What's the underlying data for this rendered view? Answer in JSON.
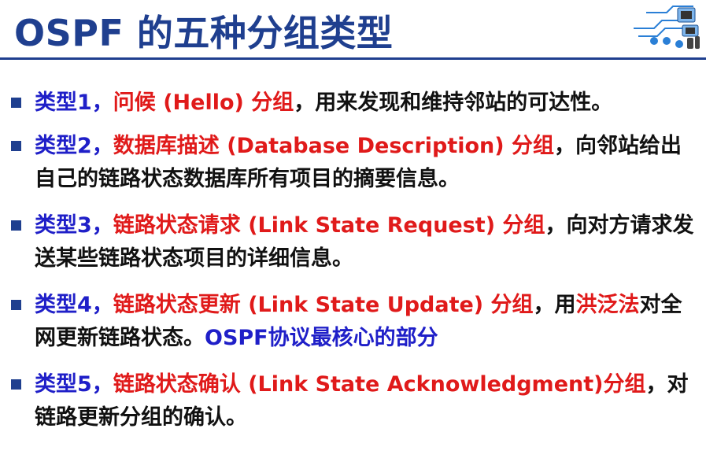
{
  "title": "OSPF 的五种分组类型",
  "colors": {
    "title": "#1f3f8f",
    "type": "#1f1fc8",
    "name": "#e01a1a",
    "text": "#111111"
  },
  "logo": {
    "icon": "network-computers-icon"
  },
  "items": [
    {
      "type": "类型1，",
      "name": "问候 (Hello) 分组",
      "desc": "，用来发现和维持邻站的可达性。"
    },
    {
      "type": "类型2，",
      "name": "数据库描述 (Database Description) 分组",
      "desc": "，向邻站给出自己的链路状态数据库所有项目的摘要信息。"
    },
    {
      "type": "类型3，",
      "name": "链路状态请求 (Link State Request) 分组",
      "desc": "，向对方请求发送某些链路状态项目的详细信息。"
    },
    {
      "type": "类型4，",
      "name": "链路状态更新 (Link State Update) 分组",
      "desc_a": "，用",
      "highlight": "洪泛法",
      "desc_b": "对全网更新链路状态。",
      "note": "OSPF协议最核心的部分"
    },
    {
      "type": "类型5，",
      "name": "链路状态确认 (Link State Acknowledgment)分组",
      "desc": "，对链路更新分组的确认。"
    }
  ]
}
